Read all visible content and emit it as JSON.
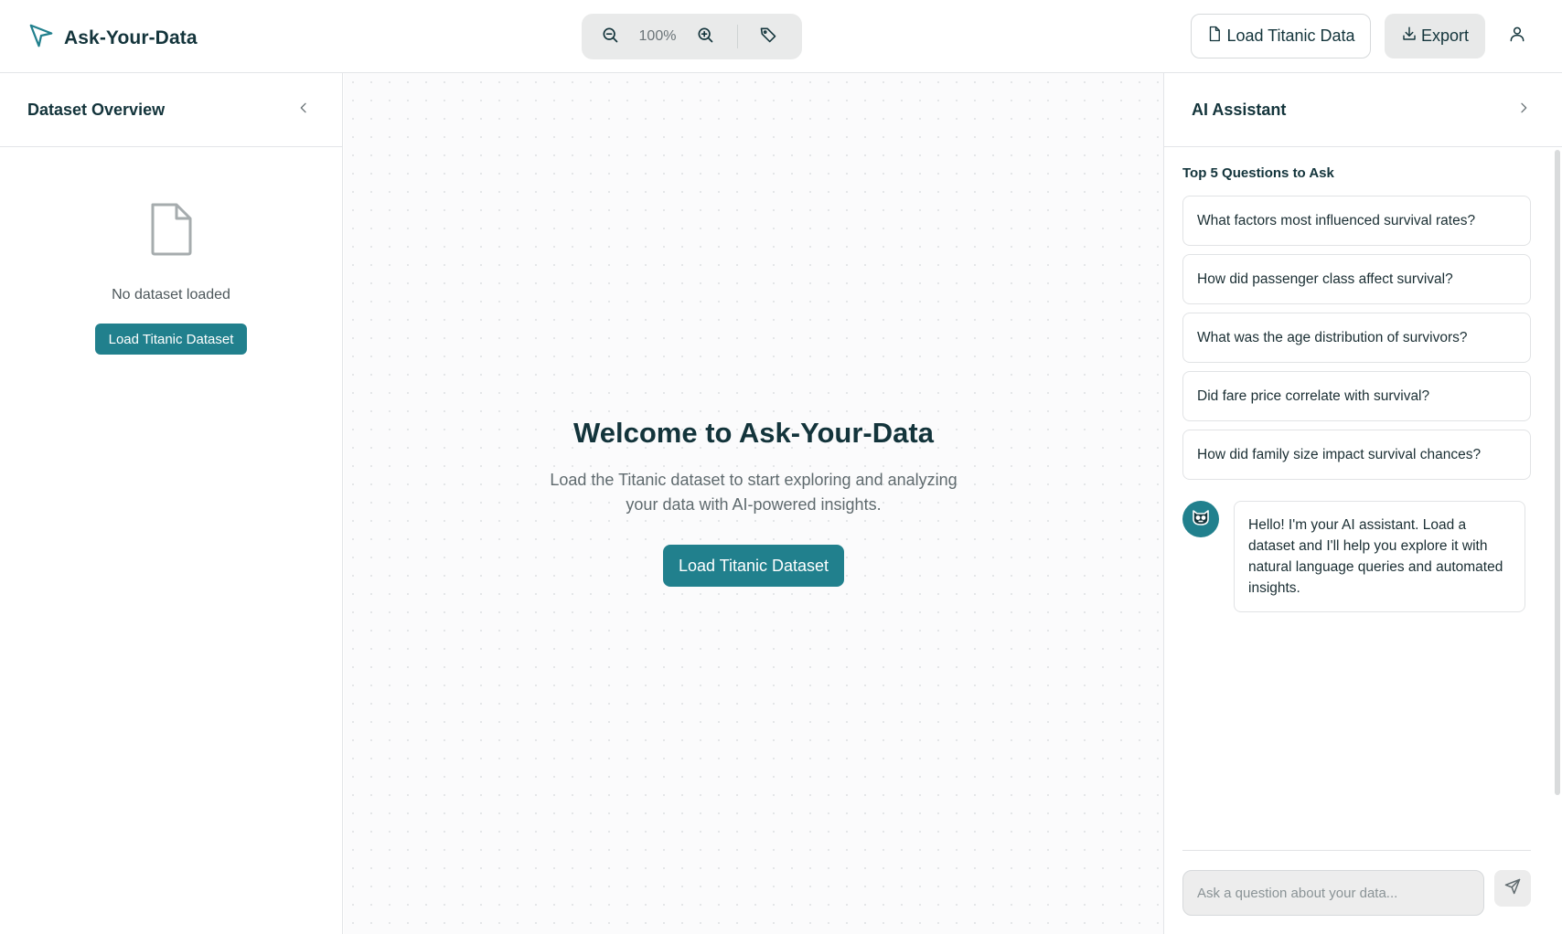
{
  "header": {
    "app_title": "Ask-Your-Data",
    "zoom_level": "100%",
    "load_button_label": "Load Titanic Data",
    "export_button_label": "Export"
  },
  "left_panel": {
    "title": "Dataset Overview",
    "empty_text": "No dataset loaded",
    "load_button_label": "Load Titanic Dataset"
  },
  "main": {
    "welcome_title": "Welcome to Ask-Your-Data",
    "welcome_text": "Load the Titanic dataset to start exploring and analyzing your data with AI-powered insights.",
    "load_button_label": "Load Titanic Dataset"
  },
  "assistant": {
    "title": "AI Assistant",
    "questions_title": "Top 5 Questions to Ask",
    "questions": [
      "What factors most influenced survival rates?",
      "How did passenger class affect survival?",
      "What was the age distribution of survivors?",
      "Did fare price correlate with survival?",
      "How did family size impact survival chances?"
    ],
    "greeting": "Hello! I'm your AI assistant. Load a dataset and I'll help you explore it with natural language queries and automated insights.",
    "input_placeholder": "Ask a question about your data..."
  },
  "colors": {
    "accent": "#21808d",
    "text": "#13343b",
    "border": "#e3e5e8"
  }
}
